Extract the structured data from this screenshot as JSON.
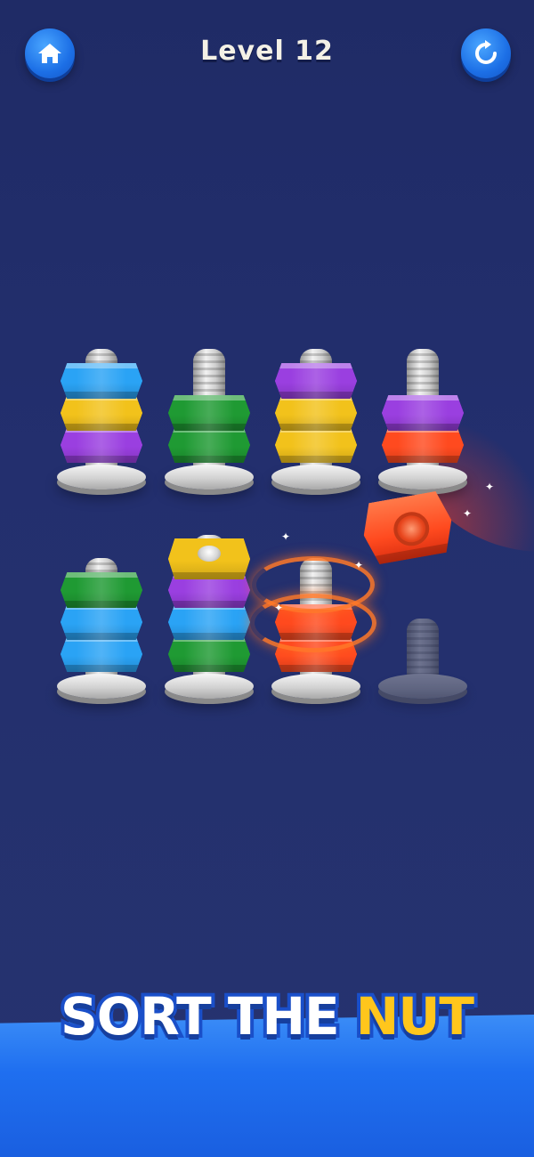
{
  "header": {
    "level_title": "Level 12",
    "home_icon": "home-icon",
    "restart_icon": "restart-icon"
  },
  "colors": {
    "blue": "#2aa3f5",
    "yellow": "#f2c21b",
    "purple": "#9a3fe0",
    "green": "#1f9a33",
    "red": "#ff4a1f"
  },
  "bolts": [
    {
      "row": 1,
      "col": 1,
      "nuts_bottom_to_top": [
        "purple",
        "yellow",
        "blue"
      ]
    },
    {
      "row": 1,
      "col": 2,
      "nuts_bottom_to_top": [
        "green",
        "green"
      ]
    },
    {
      "row": 1,
      "col": 3,
      "nuts_bottom_to_top": [
        "yellow",
        "yellow",
        "purple"
      ]
    },
    {
      "row": 1,
      "col": 4,
      "nuts_bottom_to_top": [
        "red",
        "purple"
      ]
    },
    {
      "row": 2,
      "col": 1,
      "nuts_bottom_to_top": [
        "blue",
        "blue",
        "green"
      ]
    },
    {
      "row": 2,
      "col": 2,
      "nuts_bottom_to_top": [
        "green",
        "blue",
        "purple",
        "yellow"
      ]
    },
    {
      "row": 2,
      "col": 3,
      "nuts_bottom_to_top": [
        "red",
        "red"
      ]
    },
    {
      "row": 2,
      "col": 4,
      "nuts_bottom_to_top": [],
      "state": "ghost"
    }
  ],
  "flying_nut": {
    "color": "red"
  },
  "banner": {
    "word1": "SORT THE ",
    "word2": "NUT"
  }
}
